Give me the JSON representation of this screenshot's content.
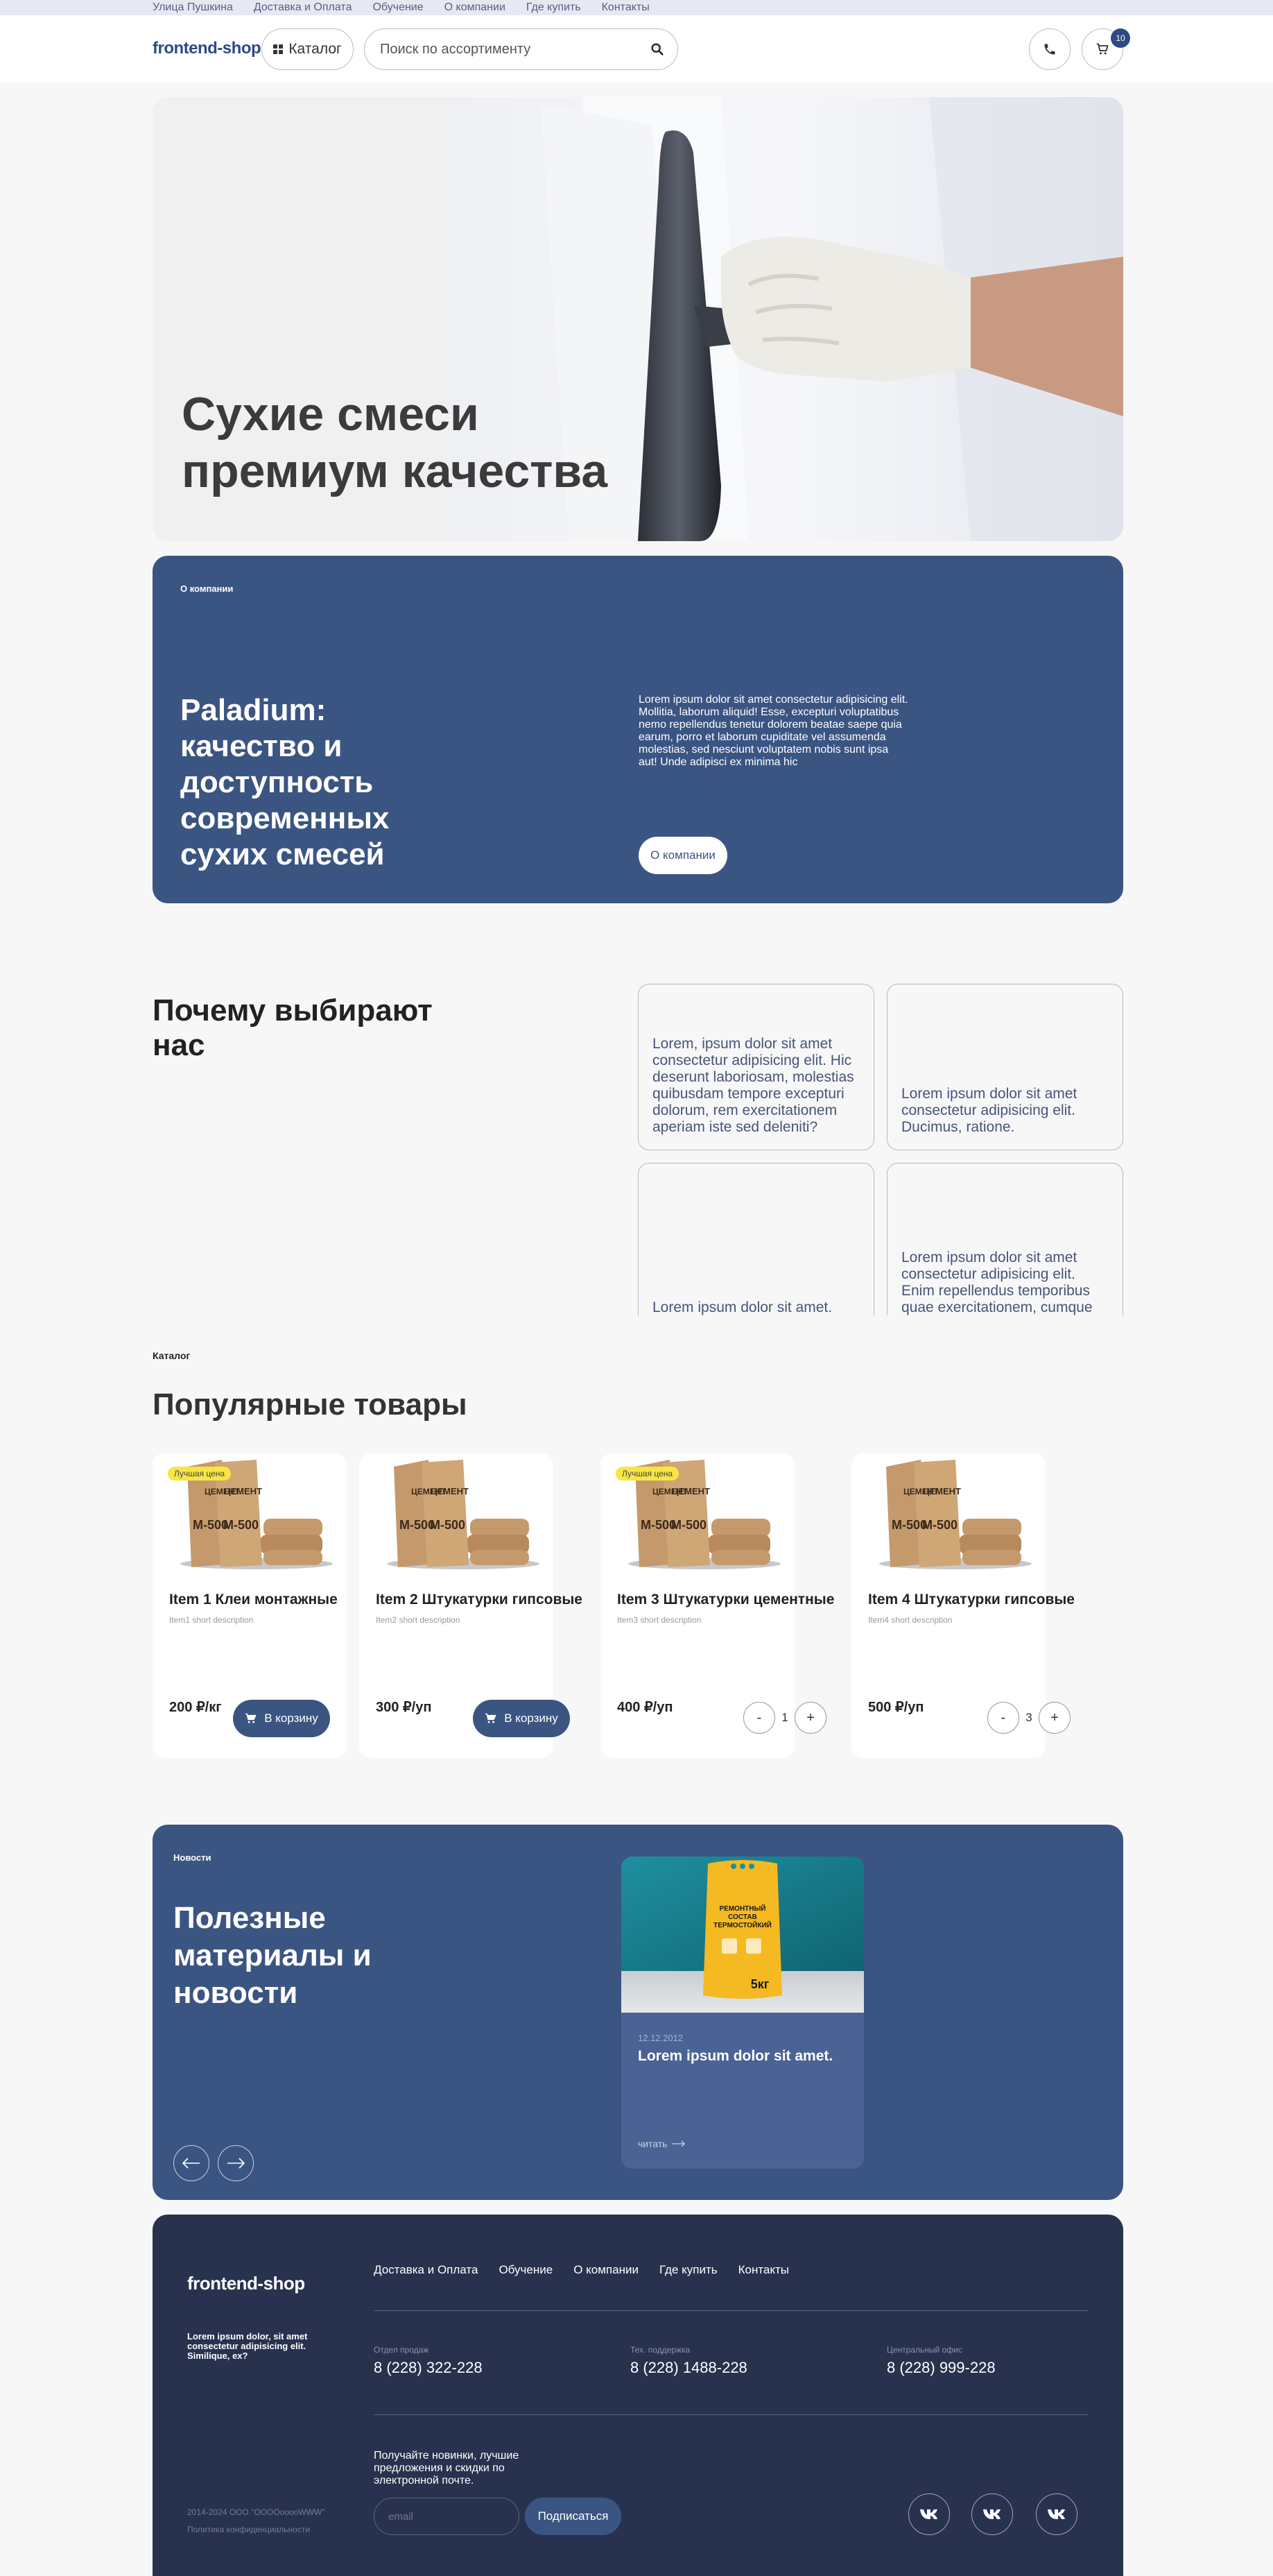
{
  "topbar": {
    "links": [
      "Улица Пушкина",
      "Доставка и Оплата",
      "Обучение",
      "О компании",
      "Где купить",
      "Контакты"
    ]
  },
  "header": {
    "logo": "frontend-shop",
    "catalog_label": "Каталог",
    "search_placeholder": "Поиск по ассортименту",
    "cart_count": "10",
    "icons": [
      "grid-icon",
      "search-icon",
      "phone-icon",
      "cart-icon"
    ]
  },
  "hero": {
    "title": "Сухие смеси премиум качества"
  },
  "about": {
    "kicker": "О компании",
    "title": "Paladium: качество и доступность современных сухих смесей",
    "text": "Lorem ipsum dolor sit amet consectetur adipisicing elit. Mollitia, laborum aliquid! Esse, excepturi voluptatibus nemo repellendus tenetur dolorem beatae saepe quia earum, porro et laborum cupiditate vel assumenda molestias, sed nesciunt voluptatem nobis sunt ipsa aut! Unde adipisci ex minima hic",
    "button": "О компании"
  },
  "why": {
    "title": "Почему выбирают нас",
    "cards": [
      "Lorem, ipsum dolor sit amet consectetur adipisicing elit. Hic deserunt laboriosam, molestias quibusdam tempore excepturi dolorum, rem exercitationem aperiam iste sed deleniti?",
      "Lorem ipsum dolor sit amet consectetur adipisicing elit. Ducimus, ratione.",
      "Lorem ipsum dolor sit amet.",
      "Lorem ipsum dolor sit amet consectetur adipisicing elit. Enim repellendus temporibus quae exercitationem, cumque quis."
    ]
  },
  "catalog": {
    "kicker": "Каталог",
    "title": "Популярные товары",
    "products": [
      {
        "title": "Item 1 Клеи монтажные",
        "desc": "Item1 short description",
        "price": "200 ₽/кг",
        "badge": "Лучшая цена",
        "button": "В корзину"
      },
      {
        "title": "Item 2 Штукатурки гипсовые",
        "desc": "Item2 short description",
        "price": "300 ₽/уп",
        "badge": "",
        "button": "В корзину"
      },
      {
        "title": "Item 3 Штукатурки цементные",
        "desc": "Item3 short description",
        "price": "400 ₽/уп",
        "badge": "Лучшая цена",
        "qty": "1"
      },
      {
        "title": "Item 4 Штукатурки гипсовые",
        "desc": "Item4 short description",
        "price": "500 ₽/уп",
        "badge": "",
        "qty": "3"
      }
    ],
    "bag_label_1": "ЦЕМЕНТ",
    "bag_label_2": "М-500",
    "stepper_minus": "-",
    "stepper_plus": "+"
  },
  "news": {
    "kicker": "Новости",
    "title": "Полезные материалы и новости",
    "card": {
      "date": "12.12.2012",
      "title": "Lorem ipsum dolor sit amet.",
      "read": "читать",
      "pack_line1": "РЕМОНТНЫЙ",
      "pack_line2": "СОСТАВ",
      "pack_line3": "ТЕРМОСТОЙКИЙ",
      "pack_weight": "5кг"
    }
  },
  "footer": {
    "logo": "frontend-shop",
    "about": "Lorem ipsum dolor, sit amet consectetur adipisicing elit. Similique, ex?",
    "nav": [
      "Доставка и Оплата",
      "Обучение",
      "О компании",
      "Где купить",
      "Контакты"
    ],
    "contacts": [
      {
        "label": "Отдел продаж",
        "number": "8 (228) 322-228"
      },
      {
        "label": "Тех. поддержка",
        "number": "8 (228) 1488-228"
      },
      {
        "label": "Центральный офис",
        "number": "8 (228) 999-228"
      }
    ],
    "subscribe_text": "Получайте новинки, лучшие предложения и скидки по электронной почте.",
    "email_placeholder": "email",
    "subscribe_button": "Подписаться",
    "copyright": "2014-2024 ООО \"ООООооооWWW\"",
    "privacy": "Политика конфиденциальности",
    "social": [
      "vk-icon",
      "vk-icon",
      "vk-icon"
    ]
  },
  "colors": {
    "primary": "#3b5583",
    "footer_bg": "#28324f",
    "badge": "#f6e545",
    "page_bg": "#f7f7f8"
  }
}
